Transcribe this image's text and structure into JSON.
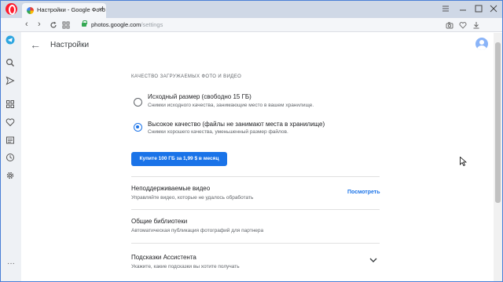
{
  "browser": {
    "tab_title": "Настройки - Google Фото",
    "tab_close": "×",
    "new_tab": "+",
    "url_host": "photos.google.com",
    "url_path": "/settings"
  },
  "page": {
    "title": "Настройки"
  },
  "upload_quality": {
    "section_title": "КАЧЕСТВО ЗАГРУЖАЕМЫХ ФОТО И ВИДЕО",
    "options": [
      {
        "title": "Исходный размер (свободно 15 ГБ)",
        "description": "Снимки исходного качества, занимающие место в вашем хранилище.",
        "selected": false
      },
      {
        "title": "Высокое качество (файлы не занимают места в хранилище)",
        "description": "Снимки хорошего качества, уменьшенный размер файлов.",
        "selected": true
      }
    ],
    "buy_button_label": "Купите 100 ГБ за 1,99 $ в месяц"
  },
  "settings_rows": [
    {
      "title": "Неподдерживаемые видео",
      "description": "Управляйте видео, которые не удалось обработать",
      "action_label": "Посмотреть"
    },
    {
      "title": "Общие библиотеки",
      "description": "Автоматическая публикация фотографий для партнера"
    },
    {
      "title": "Подсказки Ассистента",
      "description": "Укажите, какие подсказки вы хотите получать"
    }
  ],
  "colors": {
    "accent": "#1a73e8",
    "opera_red": "#ff1b2d",
    "secure_green": "#34a853"
  }
}
